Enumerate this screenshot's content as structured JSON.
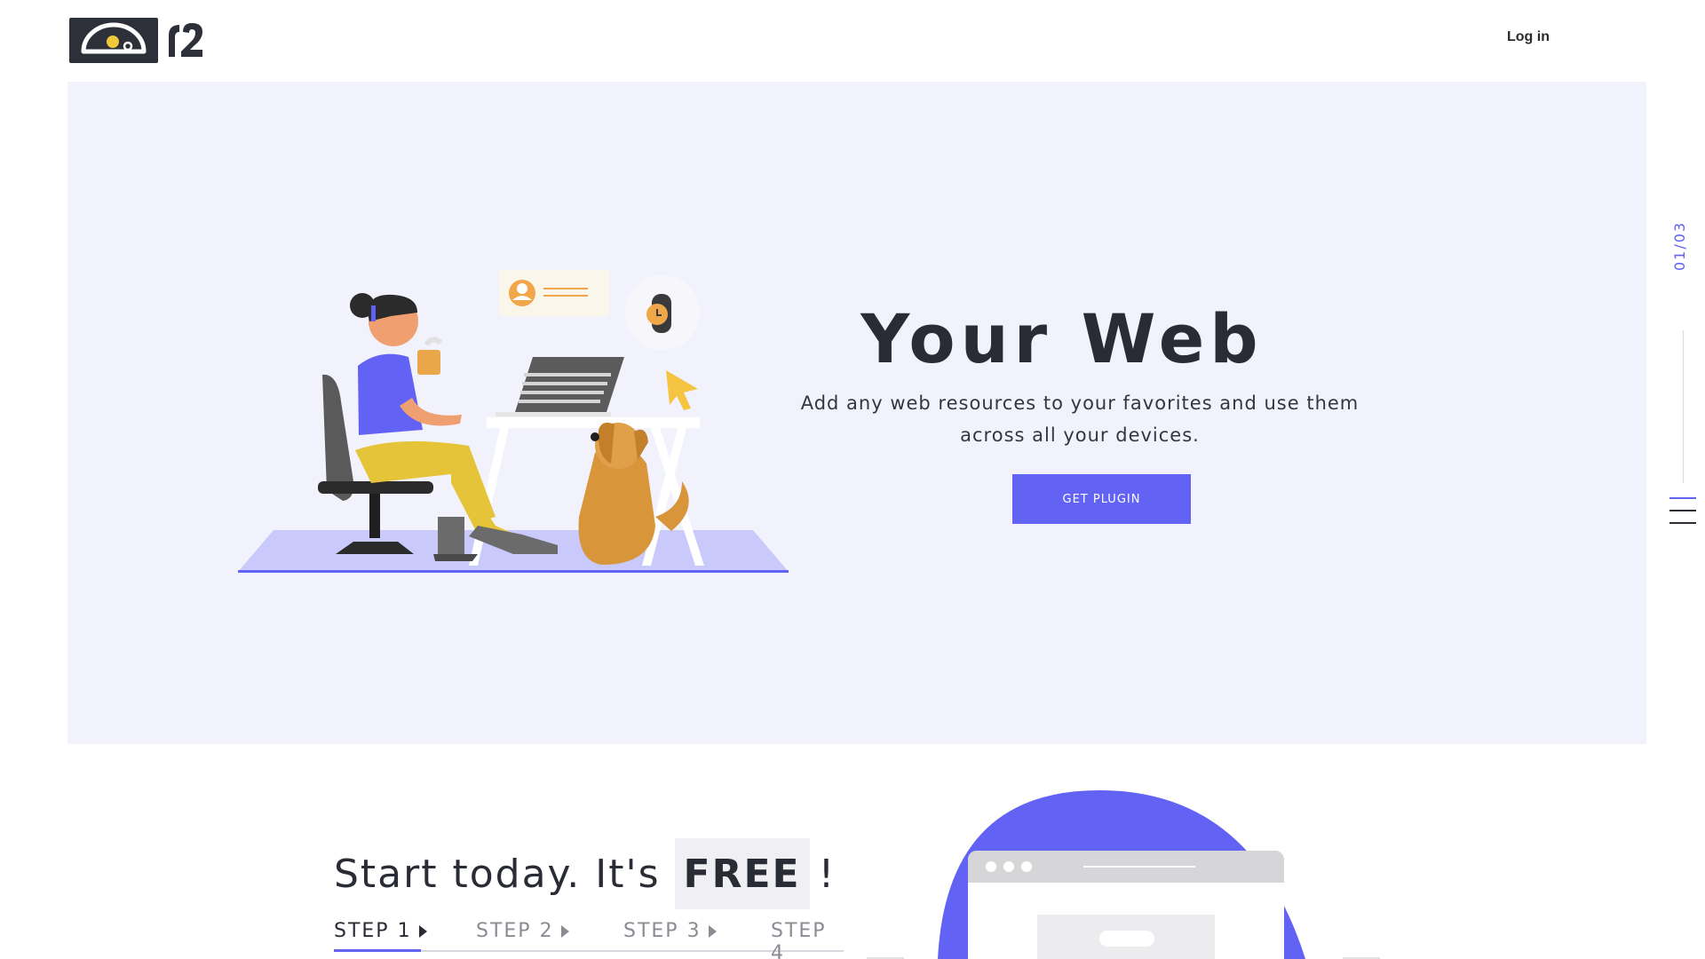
{
  "header": {
    "logo_icon": "speedometer-icon",
    "logo_mark": "r2-logo-mark",
    "login_label": "Log in"
  },
  "hero": {
    "title": "Your Web",
    "subtitle": "Add any web resources to your favorites and use them across all your devices.",
    "cta_label": "GET PLUGIN",
    "illustration": "woman-at-desk-with-dog-illustration",
    "background_color": "#f2f2fd",
    "accent_color": "#6262f5"
  },
  "pager": {
    "label": "01/03",
    "menu_icon": "hamburger-menu-icon"
  },
  "start": {
    "title_prefix": "Start today. It's",
    "title_highlight": "FREE",
    "title_suffix": "!",
    "steps": [
      {
        "label": "STEP 1",
        "active": true
      },
      {
        "label": "STEP 2",
        "active": false
      },
      {
        "label": "STEP 3",
        "active": false
      },
      {
        "label": "STEP 4",
        "active": false
      }
    ],
    "illustration": "browser-window-illustration"
  }
}
